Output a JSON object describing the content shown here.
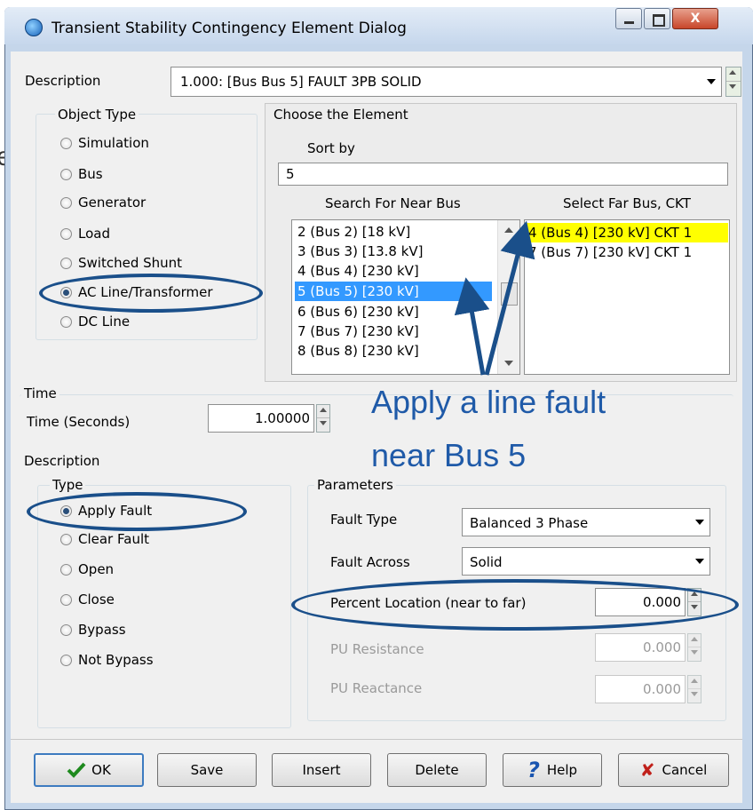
{
  "background": {
    "fragment_text": "e"
  },
  "window": {
    "title": "Transient Stability Contingency Element Dialog",
    "title_buttons": {
      "minimize": "–",
      "maximize": "□",
      "close": "X"
    }
  },
  "description_row": {
    "label": "Description",
    "value": "1.000: [Bus Bus 5] FAULT 3PB SOLID"
  },
  "object_type": {
    "legend": "Object Type",
    "options": [
      "Simulation",
      "Bus",
      "Generator",
      "Load",
      "Switched Shunt",
      "AC Line/Transformer",
      "DC Line"
    ],
    "selected": "AC Line/Transformer"
  },
  "choose_element": {
    "legend": "Choose the Element",
    "sort_by_label": "Sort by",
    "sort_value": "5",
    "near_bus_header": "Search For Near Bus",
    "far_bus_header": "Select Far Bus, CKT",
    "near_buses": [
      "2 (Bus 2)  [18 kV]",
      "3 (Bus 3)  [13.8 kV]",
      "4 (Bus 4)  [230 kV]",
      "5 (Bus 5)  [230 kV]",
      "6 (Bus 6)  [230 kV]",
      "7 (Bus 7)  [230 kV]",
      "8 (Bus 8)  [230 kV]"
    ],
    "near_selected": "5 (Bus 5)  [230 kV]",
    "far_buses": [
      "4 (Bus 4) [230 kV] CKT  1",
      "7 (Bus 7) [230 kV] CKT  1"
    ],
    "far_selected": "4 (Bus 4) [230 kV] CKT  1"
  },
  "time": {
    "legend": "Time",
    "label": "Time (Seconds)",
    "value": "1.00000"
  },
  "description_group": {
    "legend": "Description"
  },
  "type": {
    "legend": "Type",
    "options": [
      "Apply Fault",
      "Clear Fault",
      "Open",
      "Close",
      "Bypass",
      "Not Bypass"
    ],
    "selected": "Apply Fault"
  },
  "parameters": {
    "legend": "Parameters",
    "fault_type_label": "Fault Type",
    "fault_type_value": "Balanced 3 Phase",
    "fault_across_label": "Fault Across",
    "fault_across_value": "Solid",
    "percent_location_label": "Percent Location (near to far)",
    "percent_location_value": "0.000",
    "pu_resistance_label": "PU Resistance",
    "pu_resistance_value": "0.000",
    "pu_reactance_label": "PU Reactance",
    "pu_reactance_value": "0.000"
  },
  "buttons": {
    "ok": "OK",
    "save": "Save",
    "insert": "Insert",
    "delete": "Delete",
    "help": "Help",
    "cancel": "Cancel"
  },
  "annotation": {
    "line1": "Apply a line fault",
    "line2": "near Bus 5"
  },
  "colors": {
    "selection_blue": "#3399ff",
    "far_highlight_yellow": "#ffff00",
    "annotation_blue": "#1f5aa8"
  }
}
